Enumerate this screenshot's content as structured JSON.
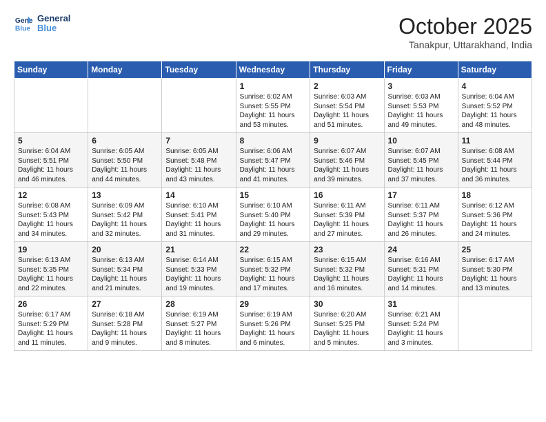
{
  "header": {
    "logo_line1": "General",
    "logo_line2": "Blue",
    "month": "October 2025",
    "location": "Tanakpur, Uttarakhand, India"
  },
  "weekdays": [
    "Sunday",
    "Monday",
    "Tuesday",
    "Wednesday",
    "Thursday",
    "Friday",
    "Saturday"
  ],
  "weeks": [
    [
      {
        "day": "",
        "text": ""
      },
      {
        "day": "",
        "text": ""
      },
      {
        "day": "",
        "text": ""
      },
      {
        "day": "1",
        "text": "Sunrise: 6:02 AM\nSunset: 5:55 PM\nDaylight: 11 hours and 53 minutes."
      },
      {
        "day": "2",
        "text": "Sunrise: 6:03 AM\nSunset: 5:54 PM\nDaylight: 11 hours and 51 minutes."
      },
      {
        "day": "3",
        "text": "Sunrise: 6:03 AM\nSunset: 5:53 PM\nDaylight: 11 hours and 49 minutes."
      },
      {
        "day": "4",
        "text": "Sunrise: 6:04 AM\nSunset: 5:52 PM\nDaylight: 11 hours and 48 minutes."
      }
    ],
    [
      {
        "day": "5",
        "text": "Sunrise: 6:04 AM\nSunset: 5:51 PM\nDaylight: 11 hours and 46 minutes."
      },
      {
        "day": "6",
        "text": "Sunrise: 6:05 AM\nSunset: 5:50 PM\nDaylight: 11 hours and 44 minutes."
      },
      {
        "day": "7",
        "text": "Sunrise: 6:05 AM\nSunset: 5:48 PM\nDaylight: 11 hours and 43 minutes."
      },
      {
        "day": "8",
        "text": "Sunrise: 6:06 AM\nSunset: 5:47 PM\nDaylight: 11 hours and 41 minutes."
      },
      {
        "day": "9",
        "text": "Sunrise: 6:07 AM\nSunset: 5:46 PM\nDaylight: 11 hours and 39 minutes."
      },
      {
        "day": "10",
        "text": "Sunrise: 6:07 AM\nSunset: 5:45 PM\nDaylight: 11 hours and 37 minutes."
      },
      {
        "day": "11",
        "text": "Sunrise: 6:08 AM\nSunset: 5:44 PM\nDaylight: 11 hours and 36 minutes."
      }
    ],
    [
      {
        "day": "12",
        "text": "Sunrise: 6:08 AM\nSunset: 5:43 PM\nDaylight: 11 hours and 34 minutes."
      },
      {
        "day": "13",
        "text": "Sunrise: 6:09 AM\nSunset: 5:42 PM\nDaylight: 11 hours and 32 minutes."
      },
      {
        "day": "14",
        "text": "Sunrise: 6:10 AM\nSunset: 5:41 PM\nDaylight: 11 hours and 31 minutes."
      },
      {
        "day": "15",
        "text": "Sunrise: 6:10 AM\nSunset: 5:40 PM\nDaylight: 11 hours and 29 minutes."
      },
      {
        "day": "16",
        "text": "Sunrise: 6:11 AM\nSunset: 5:39 PM\nDaylight: 11 hours and 27 minutes."
      },
      {
        "day": "17",
        "text": "Sunrise: 6:11 AM\nSunset: 5:37 PM\nDaylight: 11 hours and 26 minutes."
      },
      {
        "day": "18",
        "text": "Sunrise: 6:12 AM\nSunset: 5:36 PM\nDaylight: 11 hours and 24 minutes."
      }
    ],
    [
      {
        "day": "19",
        "text": "Sunrise: 6:13 AM\nSunset: 5:35 PM\nDaylight: 11 hours and 22 minutes."
      },
      {
        "day": "20",
        "text": "Sunrise: 6:13 AM\nSunset: 5:34 PM\nDaylight: 11 hours and 21 minutes."
      },
      {
        "day": "21",
        "text": "Sunrise: 6:14 AM\nSunset: 5:33 PM\nDaylight: 11 hours and 19 minutes."
      },
      {
        "day": "22",
        "text": "Sunrise: 6:15 AM\nSunset: 5:32 PM\nDaylight: 11 hours and 17 minutes."
      },
      {
        "day": "23",
        "text": "Sunrise: 6:15 AM\nSunset: 5:32 PM\nDaylight: 11 hours and 16 minutes."
      },
      {
        "day": "24",
        "text": "Sunrise: 6:16 AM\nSunset: 5:31 PM\nDaylight: 11 hours and 14 minutes."
      },
      {
        "day": "25",
        "text": "Sunrise: 6:17 AM\nSunset: 5:30 PM\nDaylight: 11 hours and 13 minutes."
      }
    ],
    [
      {
        "day": "26",
        "text": "Sunrise: 6:17 AM\nSunset: 5:29 PM\nDaylight: 11 hours and 11 minutes."
      },
      {
        "day": "27",
        "text": "Sunrise: 6:18 AM\nSunset: 5:28 PM\nDaylight: 11 hours and 9 minutes."
      },
      {
        "day": "28",
        "text": "Sunrise: 6:19 AM\nSunset: 5:27 PM\nDaylight: 11 hours and 8 minutes."
      },
      {
        "day": "29",
        "text": "Sunrise: 6:19 AM\nSunset: 5:26 PM\nDaylight: 11 hours and 6 minutes."
      },
      {
        "day": "30",
        "text": "Sunrise: 6:20 AM\nSunset: 5:25 PM\nDaylight: 11 hours and 5 minutes."
      },
      {
        "day": "31",
        "text": "Sunrise: 6:21 AM\nSunset: 5:24 PM\nDaylight: 11 hours and 3 minutes."
      },
      {
        "day": "",
        "text": ""
      }
    ]
  ]
}
